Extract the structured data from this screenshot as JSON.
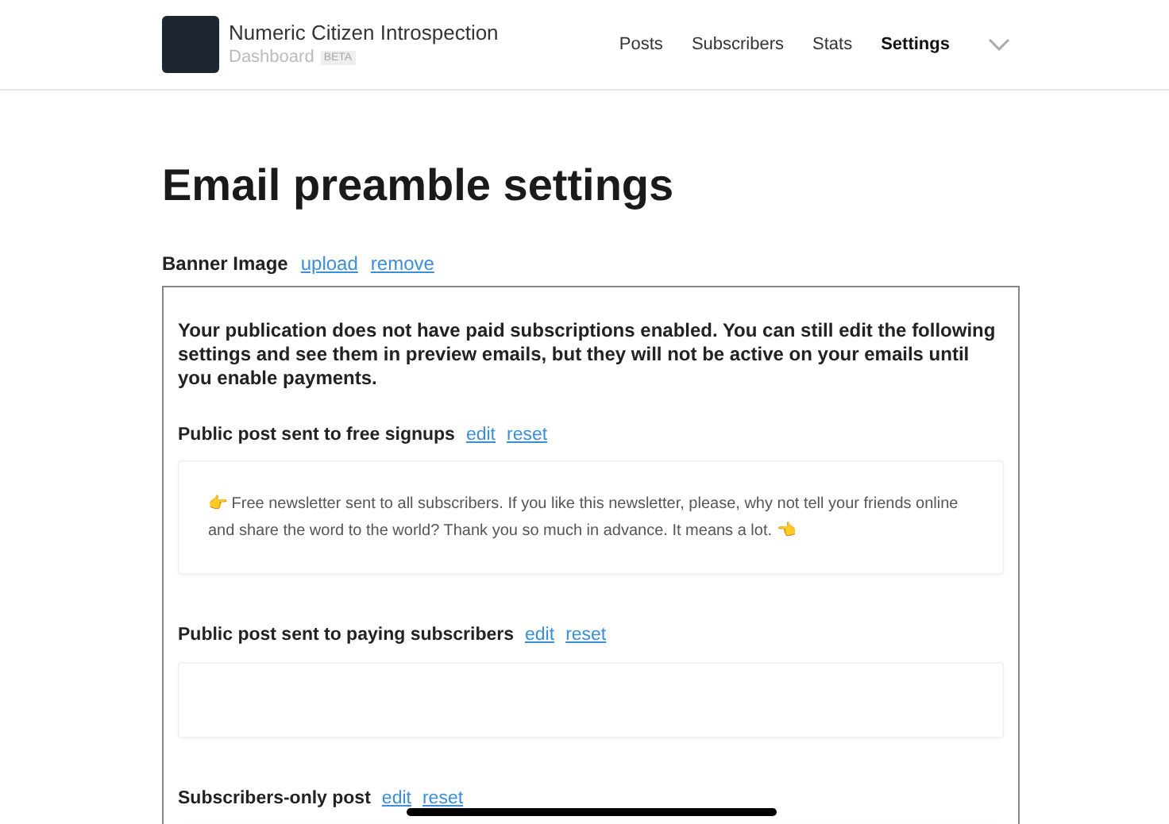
{
  "header": {
    "publication": "Numeric Citizen Introspection",
    "subtitle": "Dashboard",
    "badge": "BETA",
    "nav": [
      {
        "label": "Posts",
        "selected": false
      },
      {
        "label": "Subscribers",
        "selected": false
      },
      {
        "label": "Stats",
        "selected": false
      },
      {
        "label": "Settings",
        "selected": true
      }
    ]
  },
  "page_title": "Email preamble settings",
  "banner": {
    "label": "Banner Image",
    "actions": [
      "upload",
      "remove"
    ]
  },
  "notice": "Your publication does not have paid subscriptions enabled. You can still edit the following settings and see them in preview emails, but they will not be active on your emails until you enable payments.",
  "sections": [
    {
      "label": "Public post sent to free signups",
      "actions": [
        "edit",
        "reset"
      ],
      "preview": "👉 Free newsletter sent to all subscribers. If you like this newsletter, please, why not tell your friends online and share the word to the world? Thank you so much in advance. It means a lot. 👈"
    },
    {
      "label": "Public post sent to paying subscribers",
      "actions": [
        "edit",
        "reset"
      ]
    },
    {
      "label": "Subscribers-only post",
      "actions": [
        "edit",
        "reset"
      ]
    }
  ]
}
